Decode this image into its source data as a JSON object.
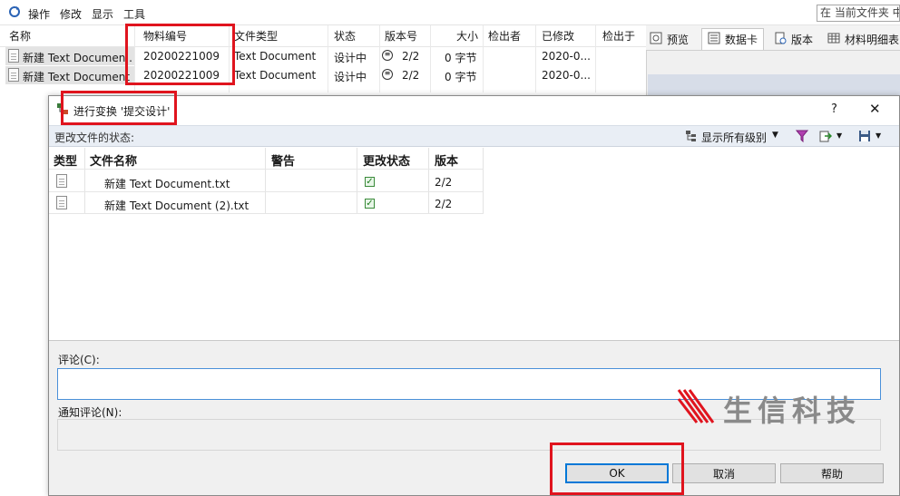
{
  "menu": {
    "items": [
      "操作",
      "修改",
      "显示",
      "工具"
    ]
  },
  "search": {
    "placeholder": "在 当前文件夹 中"
  },
  "file_list": {
    "headers": [
      "名称",
      "物料编号",
      "文件类型",
      "状态",
      "版本号",
      "大小",
      "检出者",
      "已修改",
      "检出于"
    ],
    "rows": [
      {
        "name": "新建 Text Documen...",
        "part_no": "20200221009",
        "type": "Text Document",
        "state": "设计中",
        "version": "2/2",
        "size": "0 字节",
        "modified": "2020-0..."
      },
      {
        "name": "新建 Text Document",
        "part_no": "20200221009",
        "type": "Text Document",
        "state": "设计中",
        "version": "2/2",
        "size": "0 字节",
        "modified": "2020-0..."
      }
    ]
  },
  "right_tabs": [
    "预览",
    "数据卡",
    "版本",
    "材料明细表"
  ],
  "dialog": {
    "title": "进行变换 '提交设计'",
    "help": "?",
    "close": "✕",
    "status_label": "更改文件的状态:",
    "show_levels": "显示所有级别",
    "grid_headers": [
      "类型",
      "文件名称",
      "警告",
      "更改状态",
      "版本"
    ],
    "grid_rows": [
      {
        "name": "新建 Text Document.txt",
        "version": "2/2"
      },
      {
        "name": "新建 Text Document (2).txt",
        "version": "2/2"
      }
    ],
    "comment_label": "评论(C):",
    "notify_label": "通知评论(N):",
    "ok": "OK",
    "cancel": "取消",
    "help_button": "帮助"
  },
  "watermark": {
    "text": "生信科技",
    "color": "#e0141e"
  },
  "colors": {
    "highlight": "#e0141e",
    "accent": "#0078d7"
  }
}
